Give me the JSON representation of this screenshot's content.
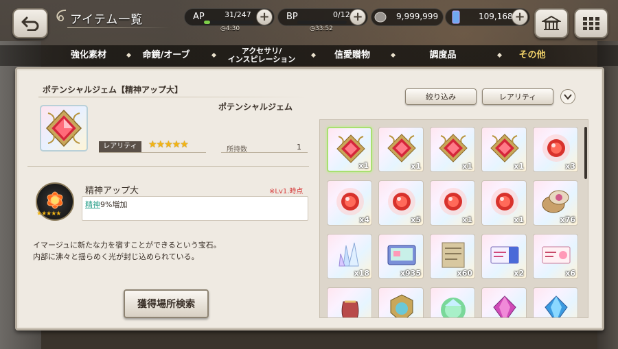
{
  "header": {
    "title": "アイテム一覧",
    "ap": {
      "label": "AP",
      "value": "31/247",
      "timer": "4:30",
      "fill": 0.126
    },
    "bp": {
      "label": "BP",
      "value": "0/12",
      "timer": "33:52"
    },
    "coins": "9,999,999",
    "gems": "109,168"
  },
  "tabs": [
    {
      "label": "強化素材"
    },
    {
      "label": "命鏡/オーブ"
    },
    {
      "label": "アクセサリ/\nインスピレーション"
    },
    {
      "label": "信愛贈物"
    },
    {
      "label": "調度品"
    },
    {
      "label": "その他",
      "active": true
    }
  ],
  "detail": {
    "name": "ポテンシャルジェム【精神アップ大】",
    "category": "ポテンシャルジェム",
    "rarity_label": "レアリティ",
    "stars": "★★★★★",
    "owned_label": "所持数",
    "owned_value": "1",
    "skill_name": "精神アップ大",
    "skill_note": "※Lv1.時点",
    "skill_stat": "精神",
    "skill_effect": "9%増加",
    "skill_stars": "★★★★★",
    "description": "イマージュに新たな力を宿すことができるという宝石。\n内部に沸々と揺らめく光が封じ込められている。",
    "find_button": "獲得場所検索"
  },
  "filters": {
    "narrow": "絞り込み",
    "rarity": "レアリティ"
  },
  "colors": {
    "accent_tab": "#f3d36a",
    "panel": "#efeae2",
    "selected": "#a8e070"
  },
  "items": [
    {
      "icon": "ornate-red-gem",
      "qty": "x1",
      "selected": true
    },
    {
      "icon": "ornate-red-gem",
      "qty": "x1"
    },
    {
      "icon": "ornate-red-gem",
      "qty": "x1"
    },
    {
      "icon": "ornate-red-gem",
      "qty": "x1"
    },
    {
      "icon": "red-orb",
      "qty": "x3"
    },
    {
      "icon": "red-orb",
      "qty": "x4"
    },
    {
      "icon": "red-orb",
      "qty": "x5"
    },
    {
      "icon": "red-orb",
      "qty": "x1"
    },
    {
      "icon": "red-orb",
      "qty": "x1"
    },
    {
      "icon": "compact-mirror",
      "qty": "x76"
    },
    {
      "icon": "crystal-cluster",
      "qty": "x18"
    },
    {
      "icon": "tablet-device",
      "qty": "x935"
    },
    {
      "icon": "old-map",
      "qty": "x60"
    },
    {
      "icon": "ticket-blue",
      "qty": "x2"
    },
    {
      "icon": "ticket-pink",
      "qty": "x6"
    },
    {
      "icon": "pouch",
      "qty": ""
    },
    {
      "icon": "emblem",
      "qty": ""
    },
    {
      "icon": "rainbow-gem",
      "qty": ""
    },
    {
      "icon": "purple-crystal",
      "qty": ""
    },
    {
      "icon": "blue-crystal",
      "qty": ""
    }
  ]
}
